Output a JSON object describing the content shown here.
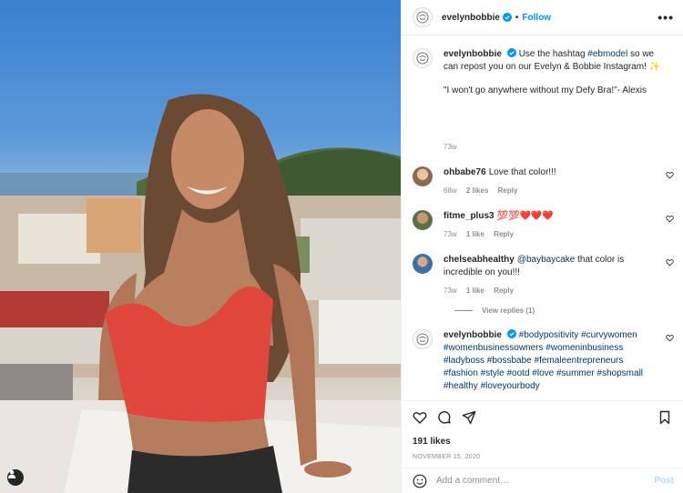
{
  "post": {
    "author": "evelynbobbie",
    "follow_label": "Follow",
    "more_label": "•••",
    "likes": "191 likes",
    "date": "NOVEMBER 15, 2020",
    "add_comment_placeholder": "Add a comment…",
    "post_label": "Post"
  },
  "caption": {
    "username": "evelynbobbie",
    "text_before": "Use the hashtag ",
    "hashtag": "#ebmodel",
    "text_after": " so we can repost you on our Evelyn & Bobbie Instagram! ✨",
    "quote": "\"I won't go anywhere without my Defy Bra!\"- Alexis",
    "age": "73w"
  },
  "comments": [
    {
      "username": "ohbabe76",
      "text": "Love that color!!!",
      "age": "68w",
      "likes": "2 likes",
      "reply": "Reply",
      "avatar_color": "#c7a07b"
    },
    {
      "username": "fitme_plus3",
      "text": "💯💯❤️❤️❤️",
      "age": "73w",
      "likes": "1 like",
      "reply": "Reply",
      "avatar_color": "#6c7a52"
    },
    {
      "username": "chelseabhealthy",
      "mention": "@baybaycake",
      "text": " that color is incredible on you!!!",
      "age": "73w",
      "likes": "1 like",
      "reply": "Reply",
      "avatar_color": "#3f6fa8"
    }
  ],
  "view_replies": "View replies (1)",
  "hashtag_comment": {
    "username": "evelynbobbie",
    "text": "#bodypositivity #curvywomen #womenbusinessowners #womeninbusiness #ladyboss #bossbabe #femaleentrepreneurs #fashion #style #ootd #love #summer #shopsmall #healthy #loveyourbody"
  },
  "colors": {
    "link": "#0095f6",
    "hashtag": "#00376b",
    "muted": "#8e8e8e",
    "verified": "#0095f6"
  }
}
